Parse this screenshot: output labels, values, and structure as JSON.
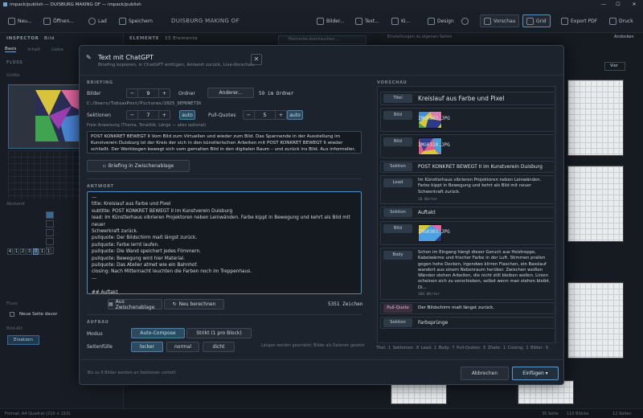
{
  "window": {
    "title": "impack/publish — DUISBURG MAKING OF — impack/publish"
  },
  "toolbar": {
    "new": "Neu...",
    "open": "Öffnen...",
    "load": "Lad",
    "save": "Speichern",
    "project_title": "DUISBURG MAKING OF",
    "images": "Bilder...",
    "text": "Text...",
    "ki": "KI...",
    "design": "Design",
    "preview": "Vorschau",
    "grid": "Grid",
    "export_pdf": "Export PDF",
    "print": "Druck"
  },
  "inspector": {
    "header": "INSPECTOR",
    "header_sub": "Bild",
    "tabs": [
      "Basis",
      "Inhalt",
      "Liebe"
    ],
    "section_flow": "FLUSS",
    "section_size": "Größe",
    "section_spacing": "Abstand",
    "section_flow2": "Fluss",
    "new_page_before": "Neue Seite davor",
    "section_image": "Bild-Alt",
    "replace_button": "Ersetzen",
    "pager": [
      "4",
      "1",
      "2",
      "3",
      "0",
      "1",
      "1"
    ]
  },
  "elements": {
    "header": "ELEMENTE",
    "count": "33 Elemente",
    "search_placeholder": "Elemente durchsuchen..."
  },
  "right": {
    "header": "Einstellungen zu eigenen Seiten",
    "anchor": "Andocken",
    "zoom": "Vier"
  },
  "statusbar": {
    "left": "Format: A4 Quadrat (210 × 210)",
    "pages": "35 Seite",
    "blocks": "110 Blöcke",
    "screens": "12 Seiten"
  },
  "dialog": {
    "title": "Text mit ChatGPT",
    "subtitle": "Briefing kopieren, in ChatGPT einfügen, Antwort zurück, Live-Vorschau.",
    "briefing_label": "BRIEFING",
    "images_label": "Bilder",
    "images_value": "9",
    "folder_label": "Ordner",
    "folder_button": "Anderer...",
    "folder_count": "59 im Ordner",
    "path": "C:/Users/TobiasPost/Pictures/2025_DEMONETIK",
    "sections_label": "Sektionen",
    "sections_value": "7",
    "auto": "auto",
    "pullquotes_label": "Pull-Quotes",
    "pullquotes_value": "5",
    "free_hint": "Freie Anweisung (Thema, Tonalität, Länge — alles optional)",
    "brief_text": "POST KONKRET BEWEGT II Vom Bild zum Virtuellen und wieder zum Bild. Das Spannende in der Ausstellung im Kunstverein Duisburg ist der Kreis der sich in den künstlerischen Arbeiten mit POST KONKRET BEWEGT II wieder schließt. Der Werkbogen bewegt sich vom gemalten Bild in den digitalen Raum – und zurück ins Bild. Aus informeller, ungegenständlicher Malerei entwickelt Tobias Post Farbräume zwischen Bild und Raum, Bewegung im Kunstraum.",
    "copy_button": "Briefing in Zwischenablage",
    "answer_label": "ANTWORT",
    "answer_lines": [
      "---",
      "title: Kreislauf aus Farbe und Pixel",
      "subtitle: POST KONKRET BEWEGT II im Kunstverein Duisburg",
      "lead: Im Künstlerhaus vibrieren Projektoren neben Leinwänden. Farbe kippt in Bewegung und kehrt als Bild mit neuer",
      "Schwerkraft zurück.",
      "pullquote: Der Bildschirm malt längst zurück.",
      "pullquote: Farbe lernt laufen.",
      "pullquote: Die Wand speichert jedes Flimmern.",
      "pullquote: Bewegung wird hier Material.",
      "pullquote: Das Atelier atmet wie ein Bahnhof.",
      "closing: Nach Mitternacht leuchten die Farben noch im Treppenhaus.",
      "---",
      "",
      "## Auftakt"
    ],
    "paste_button": "Aus Zwischenablage",
    "recalc_button": "Neu berechnen",
    "char_count": "5351 Zeichen",
    "structure_label": "AUFBAU",
    "mode_label": "Modus",
    "mode_auto": "Auto-Compose",
    "mode_strict": "Strikt (1 pro Block)",
    "fill_label": "Seitenfülle",
    "fill_loose": "locker",
    "fill_normal": "normal",
    "fill_tight": "dicht",
    "fill_hint": "Längen werden geschätzt; Bilder als Datenen gesetzt",
    "preview_label": "VORSCHAU",
    "preview": [
      {
        "tag": "Titel",
        "text": "Kreislauf aus Farbe und Pixel"
      },
      {
        "tag": "Bild",
        "text": "IMG0302.JPG"
      },
      {
        "tag": "Bild",
        "text": "IMG0310.JPG"
      },
      {
        "tag": "Sektion",
        "text": "POST KONKRET BEWEGT II im Kunstverein Duisburg"
      },
      {
        "tag": "Lead",
        "text": "Im Künstlerhaus vibrieren Projektoren neben Leinwänden. Farbe kippt in Bewegung und kehrt als Bild mit neuer Schwerkraft zurück.",
        "words": "18 Wörter"
      },
      {
        "tag": "Sektion",
        "text": "Auftakt"
      },
      {
        "tag": "Bild",
        "text": "IMG0303.JPG"
      },
      {
        "tag": "Body",
        "text": "Schon im Eingang hängt dieser Geruch aus Holztreppe, Kabelwärme und frischer Farbe in der Luft. Stimmen prallen gegen hohe Decken, irgendwo klirren Flaschen, ein Basslauf wandert aus einem Nebenraum herüber. Zwischen weißen Wänden stehen Arbeiten, die nicht still bleiben wollen. Linien scheinen sich zu verschieben, selbst wenn man stehen bleibt. Di...",
        "words": "104 Wörter"
      },
      {
        "tag": "Pull-Quote",
        "text": "Der Bildschirm malt längst zurück."
      },
      {
        "tag": "Sektion",
        "text": "Farbsprünge"
      }
    ],
    "stats": "Titel: 1   Sektionen: 8   Lead: 1   Body: 7   Pull-Quotes: 5   Zitate: 1   Closing: 1   Bilder: 9",
    "footer_hint": "Bis zu 9 Bilder werden an Sektionen verteilt",
    "cancel_button": "Abbrechen",
    "insert_button": "Einfügen ▾"
  },
  "colors": {
    "accent": "#4c7fa3",
    "dialog_bg": "#1d232c",
    "app_bg": "#141920"
  }
}
